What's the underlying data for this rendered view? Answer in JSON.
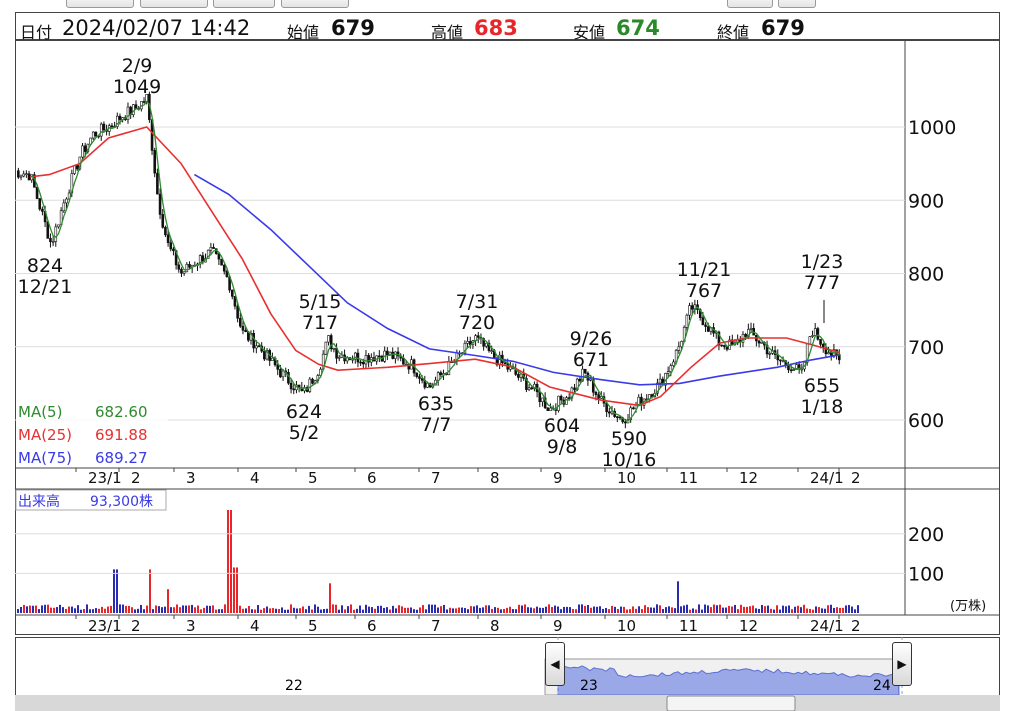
{
  "info": {
    "date_label": "日付",
    "datetime": "2024/02/07 14:42",
    "open_label": "始値",
    "open": "679",
    "high_label": "高値",
    "high": "683",
    "low_label": "安値",
    "low": "674",
    "close_label": "終値",
    "close": "679"
  },
  "legend": {
    "ma5": "MA(5)",
    "ma5_val": "682.60",
    "ma25": "MA(25)",
    "ma25_val": "691.88",
    "ma75": "MA(75)",
    "ma75_val": "689.27"
  },
  "volume": {
    "label": "出来高",
    "value": "93,300株",
    "unit": "(万株)"
  },
  "colors": {
    "up": "#e8262a",
    "down": "#2b2bb0",
    "ma5": "#2e8b2e",
    "ma25": "#e83030",
    "ma75": "#3a3ae8",
    "high": "#e8262a",
    "low": "#2a8a2a",
    "nav": "#9aa8e8"
  },
  "chart_data": {
    "type": "candlestick",
    "price_axis": {
      "range": [
        540,
        1120
      ],
      "ticks": [
        600,
        700,
        800,
        900,
        1000
      ]
    },
    "x_ticks": [
      "23/1",
      "2",
      "3",
      "4",
      "5",
      "6",
      "7",
      "8",
      "9",
      "10",
      "11",
      "12",
      "24/1",
      "2"
    ],
    "close_path": [
      [
        "12/1",
        940
      ],
      [
        "12/10",
        935
      ],
      [
        "12/21",
        840
      ],
      [
        "12/28",
        900
      ],
      [
        "1/5",
        960
      ],
      [
        "1/12",
        990
      ],
      [
        "1/20",
        1000
      ],
      [
        "1/27",
        1015
      ],
      [
        "2/3",
        1025
      ],
      [
        "2/9",
        1040
      ],
      [
        "2/15",
        900
      ],
      [
        "2/20",
        840
      ],
      [
        "2/27",
        800
      ],
      [
        "3/6",
        815
      ],
      [
        "3/15",
        830
      ],
      [
        "3/24",
        790
      ],
      [
        "3/31",
        720
      ],
      [
        "4/7",
        705
      ],
      [
        "4/15",
        680
      ],
      [
        "4/22",
        660
      ],
      [
        "5/2",
        635
      ],
      [
        "5/10",
        670
      ],
      [
        "5/15",
        710
      ],
      [
        "5/20",
        690
      ],
      [
        "6/1",
        685
      ],
      [
        "6/15",
        690
      ],
      [
        "6/28",
        675
      ],
      [
        "7/7",
        645
      ],
      [
        "7/20",
        680
      ],
      [
        "7/31",
        712
      ],
      [
        "8/8",
        690
      ],
      [
        "8/20",
        665
      ],
      [
        "8/31",
        640
      ],
      [
        "9/8",
        615
      ],
      [
        "9/18",
        635
      ],
      [
        "9/26",
        665
      ],
      [
        "10/5",
        625
      ],
      [
        "10/16",
        600
      ],
      [
        "10/25",
        625
      ],
      [
        "11/5",
        650
      ],
      [
        "11/14",
        695
      ],
      [
        "11/21",
        755
      ],
      [
        "11/28",
        735
      ],
      [
        "12/6",
        705
      ],
      [
        "12/14",
        700
      ],
      [
        "12/20",
        722
      ],
      [
        "12/28",
        705
      ],
      [
        "1/5",
        682
      ],
      [
        "1/12",
        675
      ],
      [
        "1/18",
        662
      ],
      [
        "1/23",
        725
      ],
      [
        "1/30",
        700
      ],
      [
        "2/7",
        679
      ]
    ],
    "ma25_path": [
      [
        "12/10",
        932
      ],
      [
        "12/20",
        935
      ],
      [
        "1/5",
        950
      ],
      [
        "1/20",
        985
      ],
      [
        "2/9",
        1000
      ],
      [
        "2/27",
        950
      ],
      [
        "3/15",
        885
      ],
      [
        "3/31",
        820
      ],
      [
        "4/15",
        745
      ],
      [
        "4/28",
        695
      ],
      [
        "5/10",
        676
      ],
      [
        "5/20",
        668
      ],
      [
        "6/15",
        672
      ],
      [
        "7/7",
        677
      ],
      [
        "7/31",
        683
      ],
      [
        "8/20",
        672
      ],
      [
        "9/8",
        645
      ],
      [
        "10/5",
        627
      ],
      [
        "10/25",
        620
      ],
      [
        "11/5",
        632
      ],
      [
        "11/21",
        672
      ],
      [
        "12/6",
        705
      ],
      [
        "12/20",
        712
      ],
      [
        "1/10",
        712
      ],
      [
        "1/23",
        703
      ],
      [
        "2/7",
        692
      ]
    ],
    "ma75_path": [
      [
        "3/6",
        935
      ],
      [
        "3/24",
        908
      ],
      [
        "4/15",
        860
      ],
      [
        "5/5",
        810
      ],
      [
        "5/25",
        760
      ],
      [
        "6/15",
        725
      ],
      [
        "7/7",
        697
      ],
      [
        "7/31",
        688
      ],
      [
        "8/20",
        680
      ],
      [
        "9/10",
        665
      ],
      [
        "10/5",
        655
      ],
      [
        "10/25",
        648
      ],
      [
        "11/15",
        650
      ],
      [
        "12/6",
        660
      ],
      [
        "1/5",
        672
      ],
      [
        "1/23",
        682
      ],
      [
        "2/7",
        689
      ]
    ],
    "annotations": [
      {
        "date": "2/9",
        "value": "1049"
      },
      {
        "date": "12/21",
        "value": "824"
      },
      {
        "date": "5/15",
        "value": "717"
      },
      {
        "date": "5/2",
        "value": "624"
      },
      {
        "date": "7/31",
        "value": "720"
      },
      {
        "date": "7/7",
        "value": "635"
      },
      {
        "date": "9/26",
        "value": "671"
      },
      {
        "date": "9/8",
        "value": "604"
      },
      {
        "date": "10/16",
        "value": "590"
      },
      {
        "date": "11/21",
        "value": "767"
      },
      {
        "date": "1/23",
        "value": "777"
      },
      {
        "date": "1/18",
        "value": "655"
      }
    ],
    "volume_axis": {
      "unit": "万株",
      "ticks": [
        100,
        200
      ],
      "range": [
        0,
        260
      ]
    },
    "volume_spikes": [
      {
        "date": "2/10",
        "value": 110
      },
      {
        "date": "2/20",
        "value": 60
      },
      {
        "date": "3/24",
        "value": 260
      },
      {
        "date": "3/27",
        "value": 115
      },
      {
        "date": "5/15",
        "value": 75
      },
      {
        "date": "11/14",
        "value": 80
      },
      {
        "date": "1/23",
        "value": 110
      }
    ],
    "navigator": {
      "labels": [
        "22",
        "23",
        "24"
      ]
    }
  }
}
